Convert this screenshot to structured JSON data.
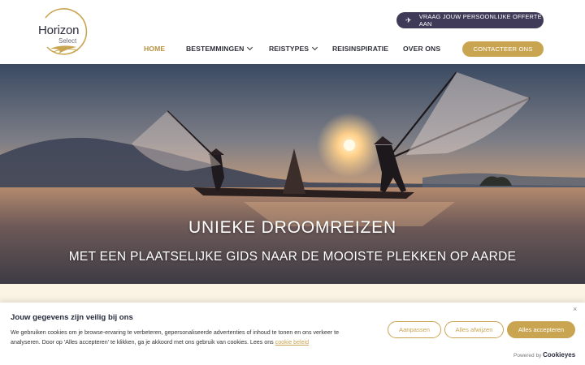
{
  "brand": {
    "name": "Horizon",
    "tagline": "Select"
  },
  "header": {
    "offer_button": "VRAAG JOUW PERSOONLIJKE OFFERTE AAN",
    "contact_button": "CONTACTEER ONS",
    "nav": [
      {
        "label": "HOME",
        "active": true
      },
      {
        "label": "BESTEMMINGEN",
        "has_dropdown": true
      },
      {
        "label": "REISTYPES",
        "has_dropdown": true
      },
      {
        "label": "REISINSPIRATIE"
      },
      {
        "label": "OVER ONS"
      }
    ]
  },
  "hero": {
    "title": "UNIEKE DROOMREIZEN",
    "subtitle": "MET EEN PLAATSELIJKE GIDS NAAR DE MOOISTE PLEKKEN OP AARDE"
  },
  "cookie": {
    "title": "Jouw gegevens zijn veilig bij ons",
    "text": "We gebruiken cookies om je browse-ervaring te verbeteren, gepersonaliseerde advertenties of inhoud te tonen en ons verkeer te analyseren. Door op 'Alles accepteren' te klikken, ga je akkoord met ons gebruik van cookies. Lees ons ",
    "link": "cookie beleid",
    "customize": "Aanpassen",
    "reject": "Alles afwijzen",
    "accept": "Alles accepteren",
    "powered_by": "Powered by",
    "powered_brand": "Cookieyes",
    "close": "×"
  },
  "colors": {
    "gold": "#c9a552",
    "navy": "#3f3a58",
    "cream": "#fbf4e4"
  }
}
